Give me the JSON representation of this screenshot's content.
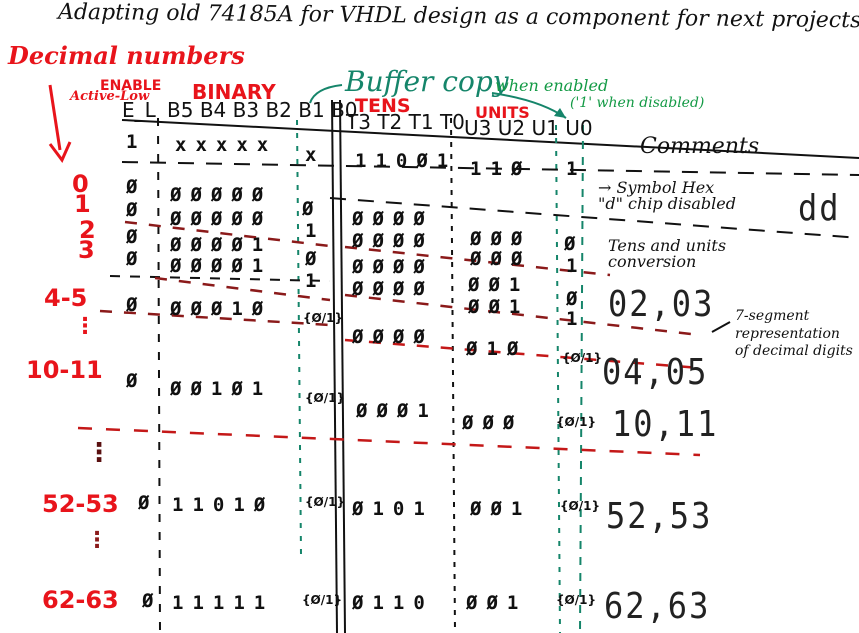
{
  "title": "Adapting old 74185A for VHDL design as a component for next projects",
  "annotations": {
    "decimal_numbers": "Decimal numbers",
    "enable": "ENABLE",
    "active_low": "Active-Low",
    "binary": "BINARY",
    "buffer_copy": "Buffer copy",
    "when_enabled": "when enabled",
    "when_disabled": "('1' when disabled)",
    "tens": "TENS",
    "units": "UNITS",
    "comments": "Comments"
  },
  "columns": {
    "enable": "E_L",
    "binary": [
      "B5",
      "B4",
      "B3",
      "B2",
      "B1",
      "B0"
    ],
    "tens": [
      "T3",
      "T2",
      "T1",
      "T0"
    ],
    "units": [
      "U3",
      "U2",
      "U1",
      "U0"
    ]
  },
  "rows": [
    {
      "decimal": "",
      "enable": "1",
      "binary": "xxxxx",
      "b0": "x",
      "tens": "110Ø1",
      "units": "11Ø",
      "u0": "1",
      "comment": "→ Symbol Hex \"d\" chip disabled",
      "segment": "dd"
    },
    {
      "decimal": "0",
      "enable": "Ø",
      "binary": "ØØØØØ",
      "b0": "Ø",
      "tens": "ØØØØ",
      "units": "ØØØ",
      "u0": "Ø",
      "comment": "",
      "segment": ""
    },
    {
      "decimal": "1",
      "enable": "Ø",
      "binary": "ØØØØØ",
      "b0": "1",
      "tens": "ØØØØ",
      "units": "ØØØ",
      "u0": "1",
      "comment": "Tens and units conversion",
      "segment": ""
    },
    {
      "decimal": "2",
      "enable": "Ø",
      "binary": "ØØØØ1",
      "b0": "Ø",
      "tens": "ØØØØ",
      "units": "ØØ1",
      "u0": "Ø",
      "comment": "",
      "segment": "02,03"
    },
    {
      "decimal": "3",
      "enable": "Ø",
      "binary": "ØØØØ1",
      "b0": "1",
      "tens": "ØØØØ",
      "units": "ØØ1",
      "u0": "1",
      "comment": "",
      "segment": ""
    },
    {
      "decimal": "4-5",
      "enable": "Ø",
      "binary": "ØØØ1Ø",
      "b0": "{Ø/1}",
      "tens": "ØØØØ",
      "units": "Ø1Ø",
      "u0": "{Ø/1}",
      "comment": "7-segment representation of decimal digits",
      "segment": "04,05"
    },
    {
      "decimal": "10-11",
      "enable": "Ø",
      "binary": "ØØ1Ø1",
      "b0": "{Ø/1}",
      "tens": "ØØØ1",
      "units": "ØØØ",
      "u0": "{Ø/1}",
      "comment": "",
      "segment": "10,11"
    },
    {
      "decimal": "52-53",
      "enable": "Ø",
      "binary": "1101Ø",
      "b0": "{Ø/1}",
      "tens": "Ø101",
      "units": "ØØ1",
      "u0": "{Ø/1}",
      "comment": "",
      "segment": "52,53"
    },
    {
      "decimal": "62-63",
      "enable": "Ø",
      "binary": "11111",
      "b0": "{Ø/1}",
      "tens": "Ø110",
      "units": "ØØ1",
      "u0": "{Ø/1}",
      "comment": "",
      "segment": "62,63"
    }
  ],
  "ellipsis": "⋮",
  "colors": {
    "ink": "#111111",
    "red": "#e8141b",
    "dark_red": "#8b1a1a",
    "green": "#139a45",
    "teal": "#15856a"
  }
}
